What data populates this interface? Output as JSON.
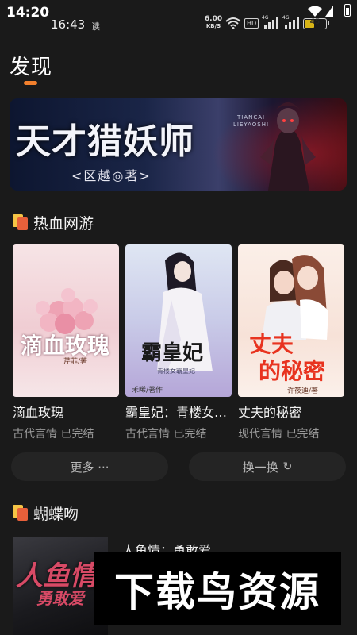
{
  "status_bar": {
    "time_outer": "14:20",
    "time_inner": "16:43",
    "app_char": "读",
    "net_speed": "6.00",
    "net_unit": "KB/S",
    "hd_label": "HD",
    "sig1_label": "4G",
    "sig2_label": "4G",
    "battery_level": "45",
    "battery_fraction": 0.45
  },
  "header": {
    "title": "发现",
    "accent_color": "#f2802d"
  },
  "banner": {
    "title": "天才猎妖师",
    "author": "<区越◎著>",
    "pinyin_line1": "TIANCAI",
    "pinyin_line2": "LIEYAOSHI"
  },
  "sections": [
    {
      "title": "热血网游",
      "books": [
        {
          "title": "滴血玫瑰",
          "meta": "古代言情 已完结",
          "cover_text": "滴血玫瑰",
          "cover_author": "芹菲/著"
        },
        {
          "title": "霸皇妃：青楼女…",
          "meta": "古代言情 已完结",
          "cover_text": "霸皇妃",
          "cover_sub": "青楼女霸皇妃",
          "cover_author": "禾晞/著作"
        },
        {
          "title": "丈夫的秘密",
          "meta": "现代言情 已完结",
          "cover_text1": "丈夫",
          "cover_text2": "的秘密",
          "cover_author": "许筱迪/著"
        }
      ],
      "more_label": "更多 ···",
      "refresh_label": "换一换",
      "refresh_icon": "refresh-icon"
    },
    {
      "title": "蝴蝶吻",
      "books": [
        {
          "title": "人鱼情：勇敢爱",
          "cover_text1": "人鱼情",
          "cover_text2": "勇敢爱"
        }
      ]
    }
  ],
  "watermark": "下载鸟资源"
}
